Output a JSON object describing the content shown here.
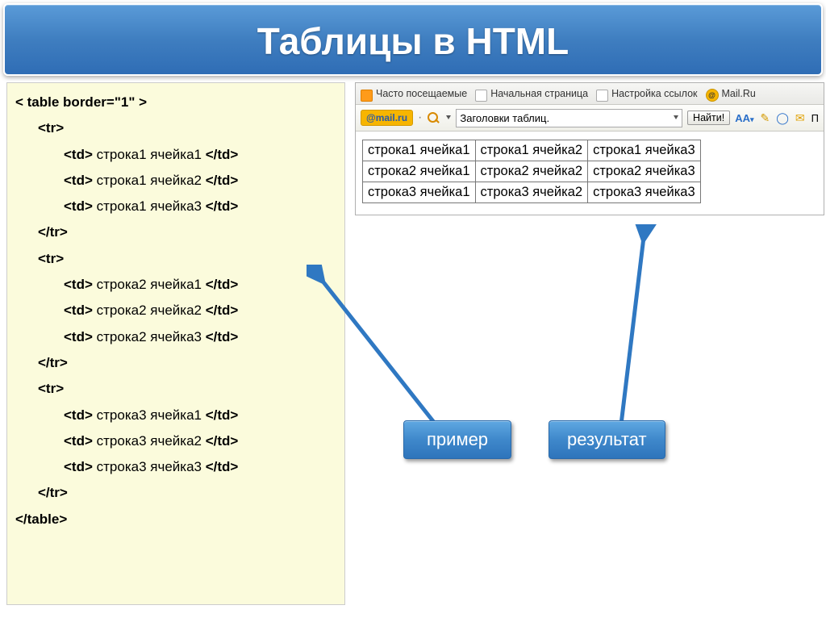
{
  "title": "Таблицы в HTML",
  "code": {
    "table_open": "< table border=\"1\" >",
    "tr_open": "<tr>",
    "tr_close": "</tr>",
    "table_close": "</table>",
    "rows": [
      [
        "<td> строка1 ячейка1 </td>",
        "<td> строка1 ячейка2 </td>",
        "<td> строка1 ячейка3 </td>"
      ],
      [
        "<td> строка2 ячейка1 </td>",
        "<td> строка2 ячейка2 </td>",
        "<td> строка2 ячейка3 </td>"
      ],
      [
        "<td> строка3 ячейка1 </td>",
        "<td> строка3 ячейка2 </td>",
        "<td> строка3 ячейка3 </td>"
      ]
    ],
    "cell_labels": {
      "td_open": "<td>",
      "td_close": "</td>",
      "r1c1": " строка1 ячейка1 ",
      "r1c2": " строка1 ячейка2 ",
      "r1c3": " строка1 ячейка3 ",
      "r2c1": " строка2 ячейка1 ",
      "r2c2": " строка2 ячейка2 ",
      "r2c3": " строка2 ячейка3 ",
      "r3c1": " строка3 ячейка1 ",
      "r3c2": " строка3 ячейка2 ",
      "r3c3": " строка3 ячейка3 "
    }
  },
  "browser": {
    "bookmarks": {
      "frequent": "Часто посещаемые",
      "start": "Начальная страница",
      "links": "Настройка ссылок",
      "mail": "Mail.Ru"
    },
    "search": {
      "badge": "@mail.ru",
      "value": "Заголовки таблиц.",
      "button": "Найти!",
      "aa": "AA",
      "p": "П"
    }
  },
  "result": {
    "cells": [
      [
        "строка1 ячейка1",
        "строка1 ячейка2",
        "строка1 ячейка3"
      ],
      [
        "строка2 ячейка1",
        "строка2 ячейка2",
        "строка2 ячейка3"
      ],
      [
        "строка3 ячейка1",
        "строка3 ячейка2",
        "строка3 ячейка3"
      ]
    ]
  },
  "callouts": {
    "example": "пример",
    "result": "результат"
  }
}
